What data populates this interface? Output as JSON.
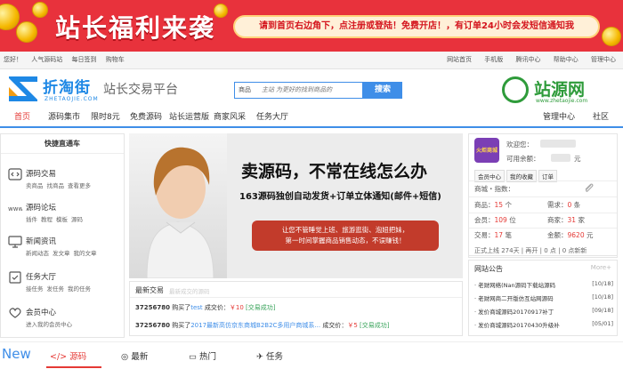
{
  "banner": {
    "title": "站长福利来袭",
    "notice": "请到首页右边角下，点注册或登陆！免费开店！，有订单24小时会发短信通知我"
  },
  "topbar": {
    "left": [
      "您好！",
      "人气源码站",
      "每日签到",
      "购物车"
    ],
    "right": [
      "网站首页",
      "手机版",
      "腾讯中心",
      "帮助中心",
      "管理中心"
    ]
  },
  "header": {
    "logo_text": "折淘街",
    "logo_domain": "ZHETAOJIE.COM",
    "slogan": "站长交易平台",
    "search_category": "商品",
    "search_placeholder": "主站 为更好的找到商品的",
    "search_button": "搜索",
    "right_logo_text": "站源网",
    "right_logo_domain": "www.zhetaojie.com"
  },
  "nav": {
    "items": [
      "首页",
      "源码集市",
      "限时8元",
      "免费源码",
      "站长运营版",
      "商家风采",
      "任务大厅"
    ],
    "right": [
      "管理中心",
      "社区"
    ]
  },
  "sidebar": {
    "head": "快捷直通车",
    "items": [
      {
        "title": "源码交易",
        "subs": [
          "卖商品",
          "找商品",
          "查看更多"
        ]
      },
      {
        "title": "源码论坛",
        "subs": [
          "插件",
          "教程",
          "模板",
          "源码"
        ]
      },
      {
        "title": "新闻资讯",
        "subs": [
          "新闻动态",
          "发文章",
          "我的文章"
        ]
      },
      {
        "title": "任务大厅",
        "subs": [
          "接任务",
          "发任务",
          "我的任务"
        ]
      },
      {
        "title": "会员中心",
        "subs": [
          "进入我的会员中心"
        ]
      }
    ]
  },
  "hero": {
    "headline": "卖源码，不常在线怎么办",
    "subline": "163源码独创自动发货+订单立体通知(邮件+短信)",
    "box_line1": "让您不管睡觉上班、旅游逛街、泡妞把妹，",
    "box_line2": "第一时间掌握商品销售动态，不误赚钱！"
  },
  "news": {
    "title": "最新交易",
    "subtitle": "最新成交的源码",
    "rows": [
      {
        "id": "37256780",
        "action": "购买了",
        "item": "test",
        "mid": "成交价：",
        "price": "￥10",
        "status": "[交易成功]"
      },
      {
        "id": "37256780",
        "action": "购买了",
        "item": "2017最新高仿京东商城B2B2C多用户商城系...",
        "mid": "成交价：",
        "price": "￥5",
        "status": "[交易成功]"
      }
    ]
  },
  "user": {
    "welcome": "欢迎您：",
    "balance": "可用余额：",
    "balance_unit": "元",
    "tabs": [
      "会员中心",
      "我的收藏",
      "订单"
    ],
    "rating": "商城・指数：",
    "stats": [
      {
        "label": "商品：",
        "value": "15",
        "unit": "个"
      },
      {
        "label": "需求：",
        "value": "0",
        "unit": "条"
      },
      {
        "label": "会员：",
        "value": "109",
        "unit": "位"
      },
      {
        "label": "商家：",
        "value": "31",
        "unit": "家"
      },
      {
        "label": "交易：",
        "value": "17",
        "unit": "笔"
      },
      {
        "label": "金额：",
        "value": "9620",
        "unit": "元"
      }
    ],
    "online": "正式上线 274天 | 再开 | 0 点 | 0 点新新"
  },
  "announcements": {
    "title": "网站公告",
    "more": "More+",
    "rows": [
      {
        "text": "· 老财网络(Nan源码下载站源码",
        "date": "[10/18]"
      },
      {
        "text": "· 老财网商二开版仿互站网源码",
        "date": "[10/18]"
      },
      {
        "text": "· 发价商城源码20170917补丁",
        "date": "[09/18]"
      },
      {
        "text": "· 发价商城源码20170430升级补",
        "date": "[05/01]"
      }
    ]
  },
  "bottom_tabs": {
    "new": "New",
    "tabs": [
      "源码",
      "最新",
      "热门",
      "任务"
    ]
  },
  "colors": {
    "brand_red": "#e8323c",
    "accent_blue": "#3f8ee8",
    "price_red": "#e53935"
  }
}
